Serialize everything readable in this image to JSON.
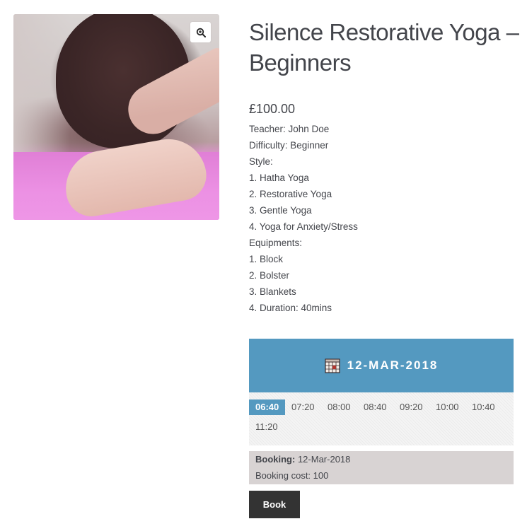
{
  "product": {
    "title": "Silence Restorative Yoga – Beginners",
    "price": "£100.00",
    "description": [
      "Teacher: John Doe",
      "Difficulty: Beginner",
      "Style:",
      "1. Hatha Yoga",
      "2. Restorative Yoga",
      "3. Gentle Yoga",
      "4. Yoga for Anxiety/Stress",
      "Equipments:",
      "1. Block",
      "2. Bolster",
      "3. Blankets",
      "4. Duration: 40mins"
    ],
    "zoom_icon": "zoom-in-icon"
  },
  "calendar": {
    "icon": "calendar-icon",
    "date": "12-MAR-2018",
    "accent_color": "#5499c0"
  },
  "slots": [
    {
      "time": "06:40",
      "selected": true
    },
    {
      "time": "07:20",
      "selected": false
    },
    {
      "time": "08:00",
      "selected": false
    },
    {
      "time": "08:40",
      "selected": false
    },
    {
      "time": "09:20",
      "selected": false
    },
    {
      "time": "10:00",
      "selected": false
    },
    {
      "time": "10:40",
      "selected": false
    },
    {
      "time": "11:20",
      "selected": false
    }
  ],
  "summary": {
    "booking_label": "Booking:",
    "booking_value": "12-Mar-2018",
    "cost_text": "Booking cost: 100"
  },
  "book_button": {
    "label": "Book"
  }
}
